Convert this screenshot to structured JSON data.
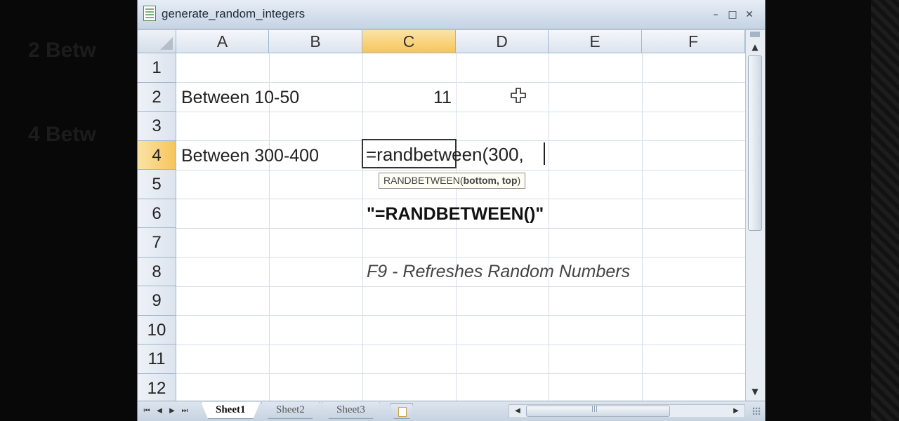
{
  "window": {
    "title": "generate_random_integers"
  },
  "columns": [
    "A",
    "B",
    "C",
    "D",
    "E",
    "F"
  ],
  "rows": [
    "1",
    "2",
    "3",
    "4",
    "5",
    "6",
    "7",
    "8",
    "9",
    "10",
    "11",
    "12"
  ],
  "active_cell": {
    "column": "C",
    "row": "4"
  },
  "cells": {
    "A2": "Between 10-50",
    "C2": "11",
    "A4": "Between 300-400",
    "C4_editing": "=randbetween(300,",
    "C6": "\"=RANDBETWEEN()\"",
    "C8": "F9 - Refreshes Random Numbers"
  },
  "tooltip": {
    "function": "RANDBETWEEN(",
    "args": "bottom, top",
    "close": ")"
  },
  "sheets": [
    "Sheet1",
    "Sheet2",
    "Sheet3"
  ],
  "active_sheet": "Sheet1",
  "icons": {
    "app": "excel-doc-icon",
    "cursor": "crosshair-cursor-icon",
    "new_sheet": "insert-worksheet-icon"
  },
  "colors": {
    "active_header": "#f6c55a",
    "grid_line": "#d6dee8",
    "header_bg": "#dce4ee"
  }
}
